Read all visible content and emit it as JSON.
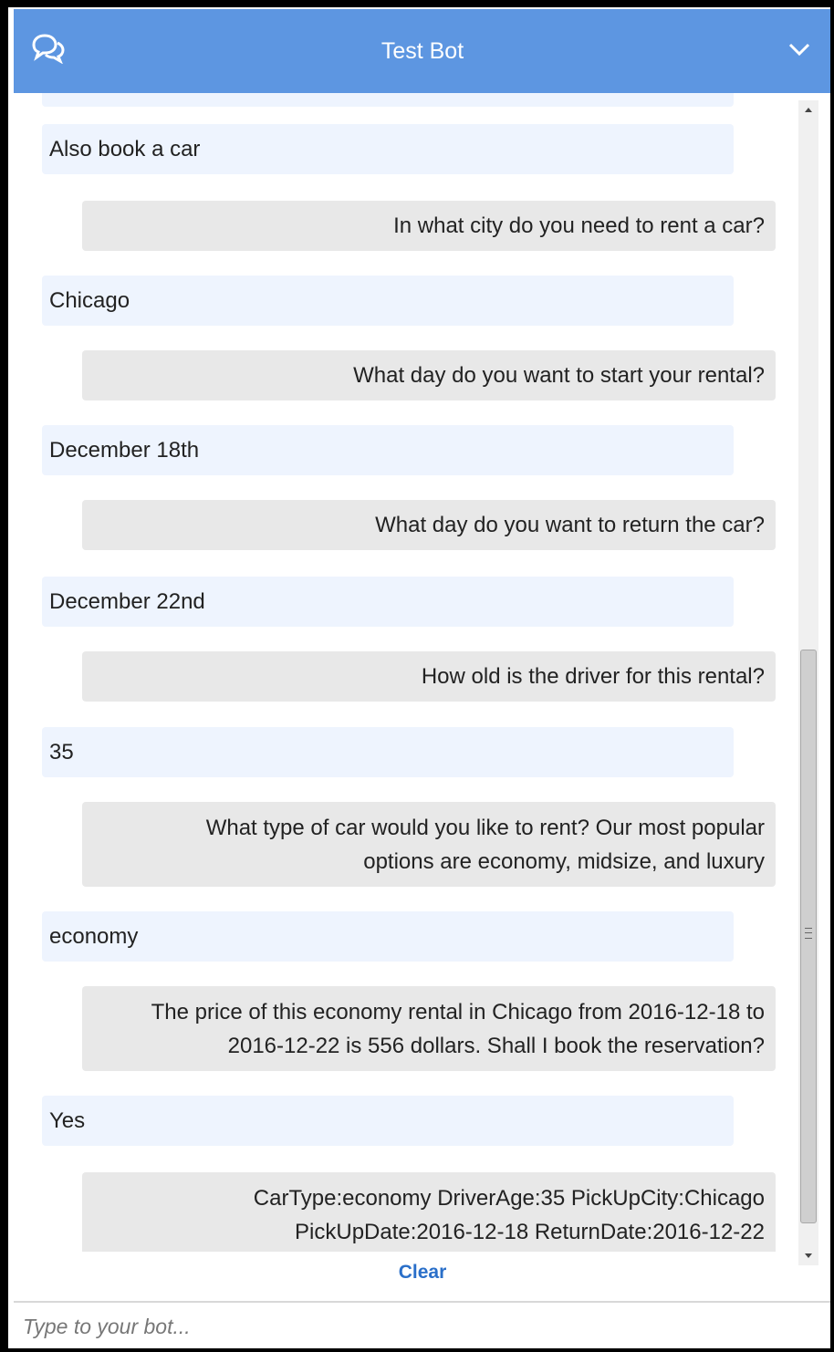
{
  "header": {
    "title": "Test Bot",
    "color": "#5d96e1",
    "left_icon": "chat-bubbles-icon",
    "right_icon": "chevron-down-icon"
  },
  "messages": [
    {
      "sender": "user",
      "text": "Also book a car"
    },
    {
      "sender": "bot",
      "text": "In what city do you need to rent a car?"
    },
    {
      "sender": "user",
      "text": "Chicago"
    },
    {
      "sender": "bot",
      "text": "What day do you want to start your rental?"
    },
    {
      "sender": "user",
      "text": "December 18th"
    },
    {
      "sender": "bot",
      "text": "What day do you want to return the car?"
    },
    {
      "sender": "user",
      "text": "December 22nd"
    },
    {
      "sender": "bot",
      "text": "How old is the driver for this rental?"
    },
    {
      "sender": "user",
      "text": "35"
    },
    {
      "sender": "bot",
      "lines": [
        "What type of car would you like to rent? Our most popular",
        "options are economy, midsize, and luxury"
      ]
    },
    {
      "sender": "user",
      "text": "economy"
    },
    {
      "sender": "bot",
      "lines": [
        "The price of this economy rental in Chicago from 2016-12-18 to",
        "2016-12-22 is 556 dollars. Shall I book the reservation?"
      ]
    },
    {
      "sender": "user",
      "text": "Yes"
    },
    {
      "sender": "bot",
      "lines": [
        "CarType:economy DriverAge:35 PickUpCity:Chicago",
        "PickUpDate:2016-12-18 ReturnDate:2016-12-22"
      ]
    }
  ],
  "clear_label": "Clear",
  "input": {
    "placeholder": "Type to your bot...",
    "value": ""
  }
}
